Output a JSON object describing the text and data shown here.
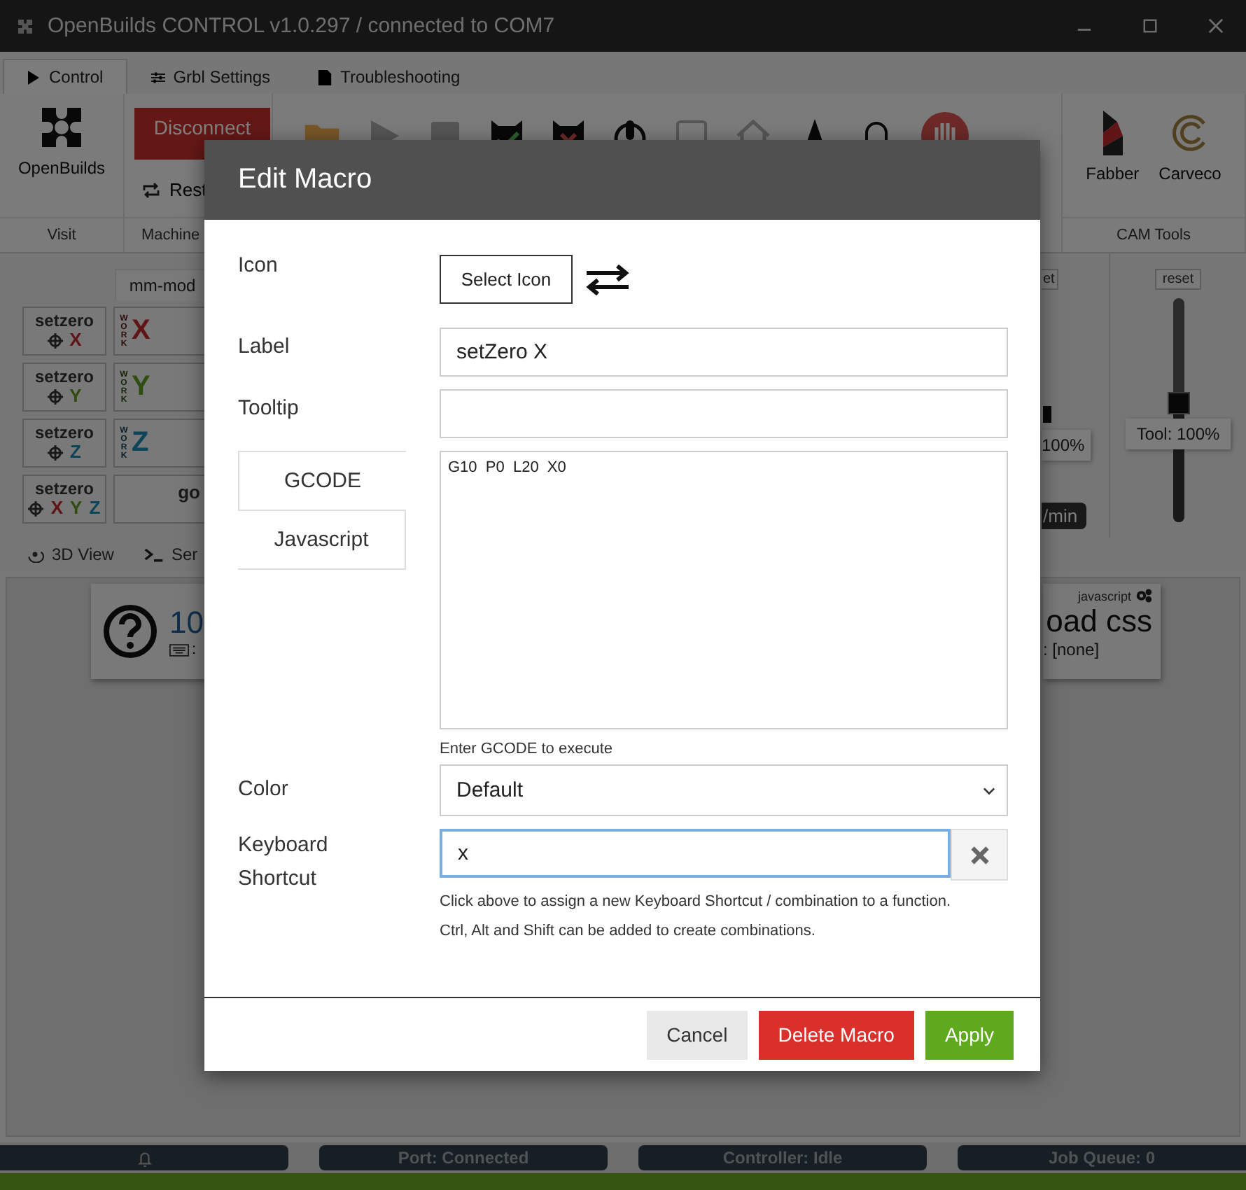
{
  "window": {
    "title": "OpenBuilds CONTROL v1.0.297 / connected to COM7"
  },
  "tabs": [
    {
      "label": "Control",
      "selected": true
    },
    {
      "label": "Grbl Settings",
      "selected": false
    },
    {
      "label": "Troubleshooting",
      "selected": false
    }
  ],
  "ribbon": {
    "openbuilds": "OpenBuilds",
    "disconnect": "Disconnect",
    "reset": "Rest",
    "visit_group": "Visit",
    "machine_group": "Machine",
    "cam_tools": [
      {
        "label": "Fabber"
      },
      {
        "label": "Carveco"
      }
    ],
    "cam_group": "CAM Tools"
  },
  "jog": {
    "unit_tab": "mm-mod",
    "setzero": [
      {
        "label": "setzero",
        "axes": [
          {
            "axis": "X",
            "color": "#601416"
          }
        ]
      },
      {
        "label": "setzero",
        "axes": [
          {
            "axis": "Y",
            "color": "#2f4d0f"
          }
        ]
      },
      {
        "label": "setzero",
        "axes": [
          {
            "axis": "Z",
            "color": "#0e445a"
          }
        ]
      },
      {
        "label": "setzero",
        "axes": [
          {
            "axis": "X",
            "color": "#601416"
          },
          {
            "axis": "Y",
            "color": "#2f4d0f"
          },
          {
            "axis": "Z",
            "color": "#0e445a"
          }
        ]
      }
    ],
    "work": [
      {
        "label": "WORK",
        "axis": "X",
        "color": "#601416"
      },
      {
        "label": "WORK",
        "axis": "Y",
        "color": "#2f4d0f"
      },
      {
        "label": "WORK",
        "axis": "Z",
        "color": "#0e445a"
      }
    ],
    "goto": "go"
  },
  "overrides": {
    "feed_reset": "et",
    "feed_reading": "100%",
    "feed_rate": "/min",
    "tool_reset": "reset",
    "tool_reading": "Tool: 100%",
    "tool_slider": {
      "level": 0.54
    }
  },
  "view_tabs": [
    {
      "label": "3D View"
    },
    {
      "label": "Ser"
    }
  ],
  "macros": [
    {
      "title": "10",
      "shortcut": ":"
    },
    {
      "kind_label": "javascript",
      "title": "oad css",
      "shortcut": ": [none]"
    }
  ],
  "status_bar": [
    "Port: Connected",
    "Controller: Idle",
    "Job Queue: 0"
  ],
  "modal": {
    "title": "Edit Macro",
    "icon_label": "Icon",
    "select_icon": "Select Icon",
    "label_label": "Label",
    "label_value": "setZero X",
    "tooltip_label": "Tooltip",
    "code_tabs": [
      {
        "label": "GCODE",
        "selected": true
      },
      {
        "label": "Javascript",
        "selected": false
      }
    ],
    "code": "G10  P0  L20  X0",
    "code_hint": "Enter GCODE to execute",
    "color_label": "Color",
    "color_value": "Default",
    "shortcut_label": "Keyboard Shortcut",
    "shortcut_value": "x",
    "shortcut_hints": [
      "Click above to assign a new Keyboard Shortcut / combination to a function.",
      "Ctrl, Alt and Shift can be added to create combinations."
    ],
    "buttons": [
      {
        "kind": "neutral",
        "label": "Cancel"
      },
      {
        "kind": "danger",
        "label": "Delete Macro"
      },
      {
        "kind": "primary",
        "label": "Apply"
      }
    ]
  }
}
